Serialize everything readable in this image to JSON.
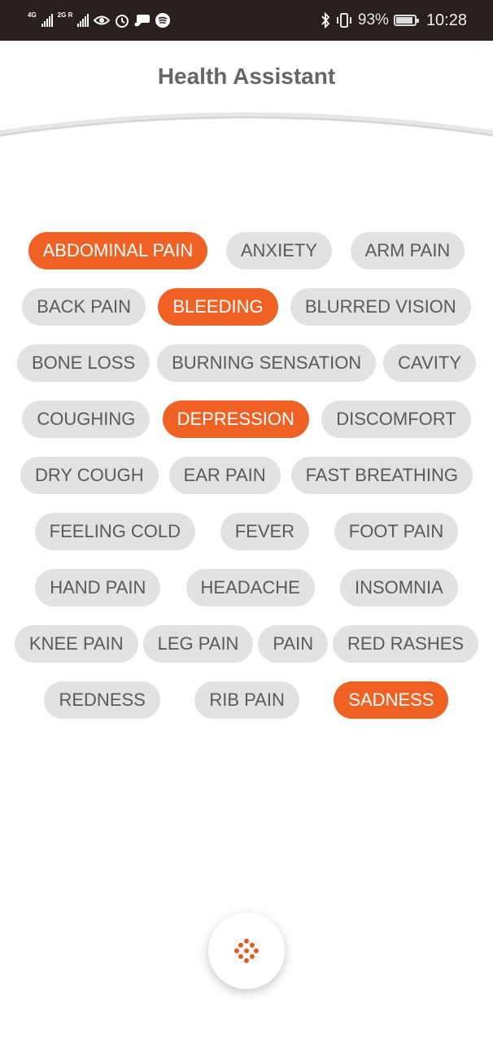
{
  "status_bar": {
    "network1": "4G",
    "network2": "2G R",
    "battery_percent": "93%",
    "battery_level": 0.93,
    "time": "10:28"
  },
  "header": {
    "title": "Health Assistant"
  },
  "colors": {
    "accent": "#f06224",
    "chip_bg": "#e2e2e2",
    "chip_text": "#5a5a5a",
    "status_bg": "#2a1f1f"
  },
  "symptoms": {
    "rows": [
      [
        {
          "label": "ABDOMINAL PAIN",
          "selected": true
        },
        {
          "label": "ANXIETY",
          "selected": false
        },
        {
          "label": "ARM PAIN",
          "selected": false
        }
      ],
      [
        {
          "label": "BACK PAIN",
          "selected": false
        },
        {
          "label": "BLEEDING",
          "selected": true
        },
        {
          "label": "BLURRED VISION",
          "selected": false
        }
      ],
      [
        {
          "label": "BONE LOSS",
          "selected": false
        },
        {
          "label": "BURNING SENSATION",
          "selected": false
        },
        {
          "label": "CAVITY",
          "selected": false
        }
      ],
      [
        {
          "label": "COUGHING",
          "selected": false
        },
        {
          "label": "DEPRESSION",
          "selected": true
        },
        {
          "label": "DISCOMFORT",
          "selected": false
        }
      ],
      [
        {
          "label": "DRY COUGH",
          "selected": false
        },
        {
          "label": "EAR PAIN",
          "selected": false
        },
        {
          "label": "FAST BREATHING",
          "selected": false
        }
      ],
      [
        {
          "label": "FEELING COLD",
          "selected": false
        },
        {
          "label": "FEVER",
          "selected": false
        },
        {
          "label": "FOOT PAIN",
          "selected": false
        }
      ],
      [
        {
          "label": "HAND PAIN",
          "selected": false
        },
        {
          "label": "HEADACHE",
          "selected": false
        },
        {
          "label": "INSOMNIA",
          "selected": false
        }
      ],
      [
        {
          "label": "KNEE PAIN",
          "selected": false
        },
        {
          "label": "LEG PAIN",
          "selected": false
        },
        {
          "label": "PAIN",
          "selected": false
        },
        {
          "label": "RED RASHES",
          "selected": false
        }
      ],
      [
        {
          "label": "REDNESS",
          "selected": false
        },
        {
          "label": "RIB PAIN",
          "selected": false
        },
        {
          "label": "SADNESS",
          "selected": true
        }
      ]
    ]
  },
  "fab": {
    "icon": "dots-grid-icon"
  }
}
